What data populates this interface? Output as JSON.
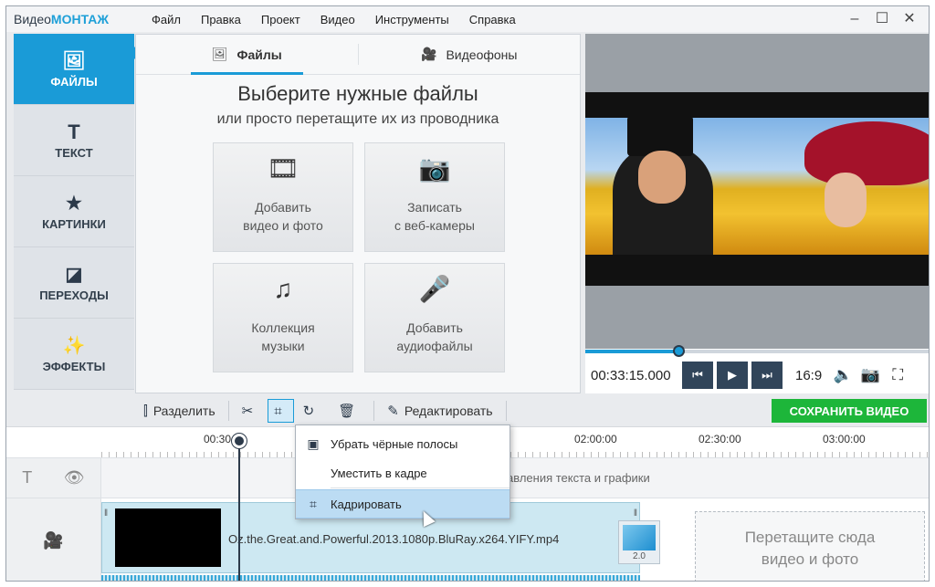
{
  "app": {
    "logo_part1": "Видео",
    "logo_part2": "МОНТАЖ"
  },
  "menu": [
    "Файл",
    "Правка",
    "Проект",
    "Видео",
    "Инструменты",
    "Справка"
  ],
  "window_buttons": [
    "–",
    "☐",
    "✕"
  ],
  "sidebar": {
    "items": [
      {
        "label": "ФАЙЛЫ",
        "icon": "image-icon",
        "active": true
      },
      {
        "label": "ТЕКСТ",
        "icon": "text-icon"
      },
      {
        "label": "КАРТИНКИ",
        "icon": "star-icon"
      },
      {
        "label": "ПЕРЕХОДЫ",
        "icon": "transition-icon"
      },
      {
        "label": "ЭФФЕКТЫ",
        "icon": "magic-wand-icon"
      }
    ]
  },
  "panel": {
    "tabs": [
      {
        "label": "Файлы",
        "icon": "image-icon",
        "active": true
      },
      {
        "label": "Видеофоны",
        "icon": "camera-icon"
      }
    ],
    "title": "Выберите нужные файлы",
    "subtitle": "или просто перетащите их из проводника",
    "tiles": [
      {
        "line1": "Добавить",
        "line2": "видео и фото",
        "icon": "film-camera-icon"
      },
      {
        "line1": "Записать",
        "line2": "с веб-камеры",
        "icon": "webcam-icon"
      },
      {
        "line1": "Коллекция",
        "line2": "музыки",
        "icon": "music-notes-icon"
      },
      {
        "line1": "Добавить",
        "line2": "аудиофайлы",
        "icon": "microphone-icon"
      }
    ]
  },
  "preview": {
    "time": "00:33:15.000",
    "aspect": "16:9",
    "progress": 0.27
  },
  "toolbar": {
    "split": "Разделить",
    "edit": "Редактировать",
    "save": "СОХРАНИТЬ ВИДЕО"
  },
  "timeline": {
    "ticks": [
      "00:30",
      "02:00:00",
      "02:30:00",
      "03:00:00"
    ],
    "text_hint": "авления текста и графики",
    "clip_name": "Oz.the.Great.and.Powerful.2013.1080p.BluRay.x264.YIFY.mp4",
    "transition_duration": "2.0",
    "dropzone_line1": "Перетащите сюда",
    "dropzone_line2": "видео и фото"
  },
  "crop_menu": {
    "items": [
      {
        "label": "Убрать чёрные полосы",
        "icon": "letterbox-icon"
      },
      {
        "label": "Уместить в кадре",
        "icon": ""
      },
      {
        "label": "Кадрировать",
        "icon": "crop-icon",
        "highlighted": true
      }
    ]
  },
  "colors": {
    "accent": "#1a9bd7",
    "save_button": "#1db63a",
    "dark_control": "#31455a"
  }
}
